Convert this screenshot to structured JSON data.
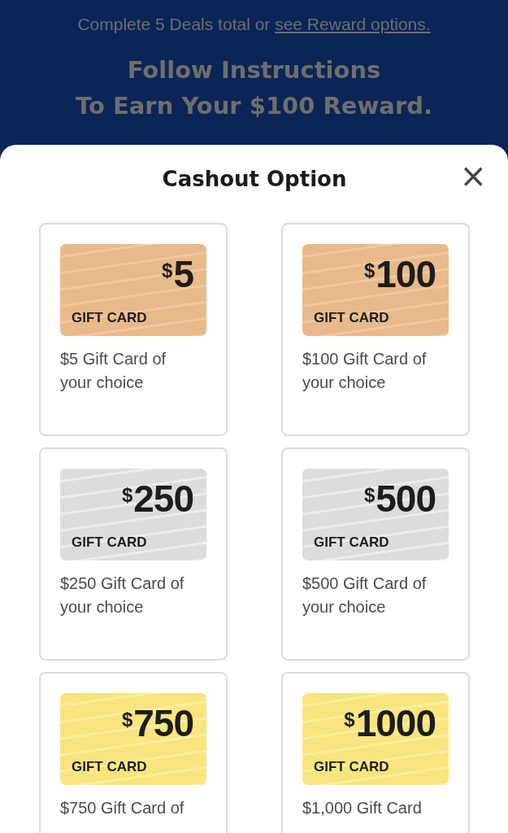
{
  "header": {
    "intro": "Complete 5 Deals total or",
    "link": "see Reward options.",
    "headline_lines": [
      "Follow Instructions",
      "To Earn Your $100 Reward."
    ]
  },
  "sheet": {
    "title": "Cashout Option",
    "close": "×",
    "options": [
      {
        "kind": "bronze",
        "currency": "$",
        "amount": "5",
        "label": "GIFT CARD",
        "description": "$5 Gift Card of your choice"
      },
      {
        "kind": "bronze",
        "currency": "$",
        "amount": "100",
        "label": "GIFT CARD",
        "description": "$100 Gift Card of your choice"
      },
      {
        "kind": "silver",
        "currency": "$",
        "amount": "250",
        "label": "GIFT CARD",
        "description": "$250 Gift Card of your choice"
      },
      {
        "kind": "silver",
        "currency": "$",
        "amount": "500",
        "label": "GIFT CARD",
        "description": "$500 Gift Card of your choice"
      },
      {
        "kind": "gold",
        "currency": "$",
        "amount": "750",
        "label": "GIFT CARD",
        "description": "$750 Gift Card of"
      },
      {
        "kind": "gold",
        "currency": "$",
        "amount": "1000",
        "label": "GIFT CARD",
        "description": "$1,000 Gift Card"
      }
    ]
  }
}
